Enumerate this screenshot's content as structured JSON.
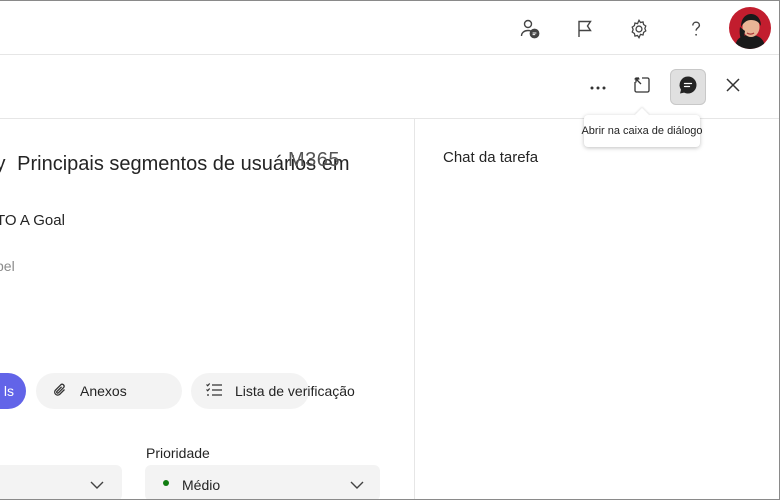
{
  "tooltip": {
    "text": "Abrir na caixa de diálogo"
  },
  "task": {
    "title_prefix": "fy",
    "title": "Principais segmentos de usuários em",
    "title_overlap": "M365",
    "bucket": "TO A Goal",
    "label_fragment": "pel",
    "chip_anexos": "Anexos",
    "chip_purple_fragment": "ls",
    "chip_lista": "Lista de verificação",
    "priority_label": "Prioridade",
    "priority_value": "Médio",
    "priority_color": "#107c10"
  },
  "chat": {
    "title": "Chat da tarefa"
  },
  "icons": {
    "header": [
      "person-chat-icon",
      "flag-icon",
      "settings-gear-icon",
      "help-icon",
      "avatar"
    ],
    "toolbar": [
      "more-options-icon",
      "open-dialog-icon",
      "chat-icon",
      "close-icon"
    ]
  },
  "colors": {
    "accent_purple": "#6264e8",
    "toolbar_active": "#e0e0e0"
  }
}
